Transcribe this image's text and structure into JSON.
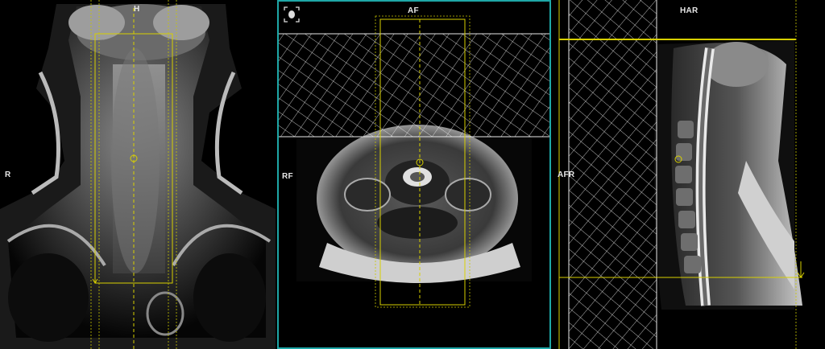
{
  "viewports": [
    {
      "id": "coronal",
      "top_label": "H",
      "left_label": "R"
    },
    {
      "id": "axial",
      "top_label": "AF",
      "left_label": "RF",
      "icon": "expand-icon"
    },
    {
      "id": "sagittal",
      "top_label": "HAR",
      "left_label": "AFR"
    }
  ],
  "colors": {
    "active_border": "#1ea7a7",
    "planning": "#d8d000",
    "saturation": "#e8e8e8"
  }
}
